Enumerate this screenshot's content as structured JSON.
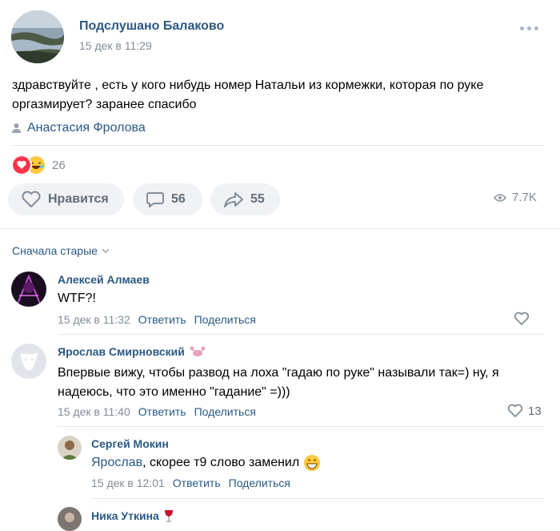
{
  "post": {
    "group_name": "Подслушано Балаково",
    "date": "15 дек в 11:29",
    "text": "здравствуйте , есть у кого нибудь номер Натальи из кормежки, которая по руке оргазмирует? заранее спасибо",
    "author": "Анастасия Фролова",
    "reactions_count": "26",
    "like_label": "Нравится",
    "comments_count": "56",
    "shares_count": "55",
    "views": "7.7K"
  },
  "comments": {
    "sort_label": "Сначала старые",
    "reply_label": "Ответить",
    "share_label": "Поделиться",
    "items": [
      {
        "name": "Алексей Алмаев",
        "text": "WTF?!",
        "date": "15 дек в 11:32",
        "likes": ""
      },
      {
        "name": "Ярослав Смирновский",
        "text": "Впервые вижу, чтобы развод на лоха \"гадаю по руке\" называли так=) ну, я надеюсь, что это именно \"гадание\" =)))",
        "date": "15 дек в 11:40",
        "likes": "13"
      },
      {
        "name": "Сергей Мокин",
        "reply_to": "Ярослав",
        "text": ", скорее т9 слово заменил",
        "date": "15 дек в 12:01",
        "likes": ""
      },
      {
        "name": "Ника Уткина",
        "text": "",
        "date": "",
        "likes": ""
      }
    ]
  },
  "colors": {
    "link": "#2a5885",
    "meta": "#818c99",
    "button_bg": "#f0f2f5"
  }
}
